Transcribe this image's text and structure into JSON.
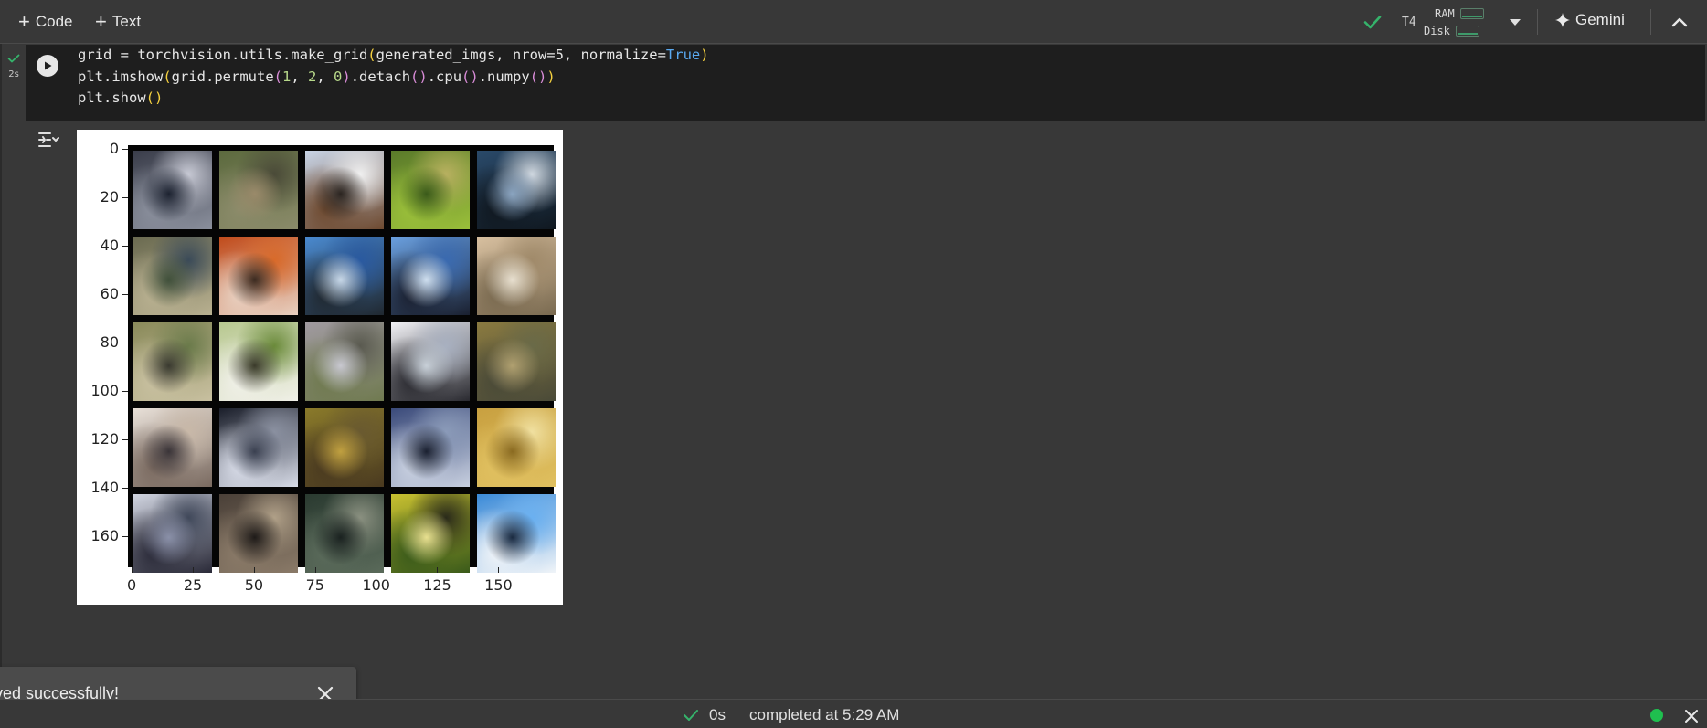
{
  "toolbar": {
    "add_code_label": "Code",
    "add_text_label": "Text",
    "runtime_type": "T4",
    "ram_label": "RAM",
    "disk_label": "Disk",
    "gemini_label": "Gemini"
  },
  "cell": {
    "exec_time": "2s",
    "code_lines": [
      "grid = torchvision.utils.make_grid(generated_imgs, nrow=5, normalize=True)",
      "plt.imshow(grid.permute(1, 2, 0).detach().cpu().numpy())",
      "plt.show()"
    ]
  },
  "output": {
    "y_ticks": [
      "0",
      "20",
      "40",
      "60",
      "80",
      "100",
      "120",
      "140",
      "160"
    ],
    "x_ticks": [
      "0",
      "25",
      "50",
      "75",
      "100",
      "125",
      "150"
    ],
    "grid_rows": 5,
    "grid_cols": 5
  },
  "toast": {
    "message": "ved successfully!"
  },
  "statusbar": {
    "duration": "0s",
    "completed": "completed at 5:29 AM"
  },
  "colors": {
    "accent_green": "#1fbf4f",
    "check_green": "#35b36b",
    "keyword_blue": "#5aa9f0"
  }
}
